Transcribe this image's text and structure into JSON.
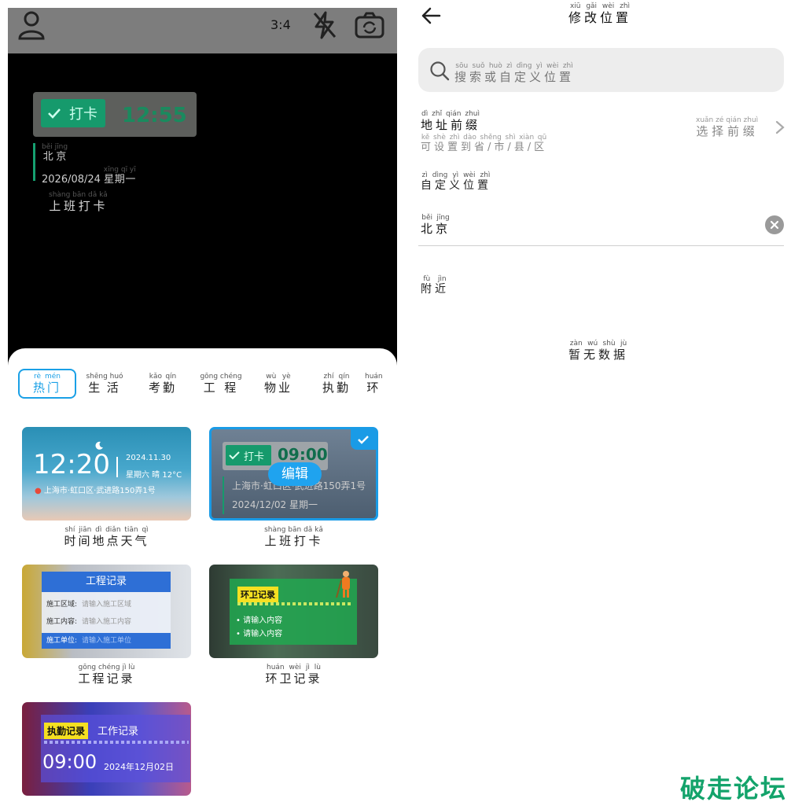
{
  "camera": {
    "ratio": "3:4",
    "icons": [
      "user-icon",
      "flash-off-icon",
      "switch-camera-icon"
    ]
  },
  "watermark_preview": {
    "chip_label": "打卡",
    "time": "12:55",
    "city": "北京",
    "city_pinyin": "běi jīng",
    "date": "2026/08/24",
    "weekday": "星期一",
    "weekday_pinyin": "xīng qī yī",
    "subtitle": "上班打卡",
    "subtitle_pinyin": "shàng bān dǎ kǎ"
  },
  "tabs": [
    {
      "label": "热门",
      "pinyin": "rè mén",
      "active": true
    },
    {
      "label": "生活",
      "pinyin": "shēng huó",
      "active": false
    },
    {
      "label": "考勤",
      "pinyin": "kǎo qín",
      "active": false
    },
    {
      "label": "工程",
      "pinyin": "gōng chéng",
      "active": false
    },
    {
      "label": "物业",
      "pinyin": "wù yè",
      "active": false
    },
    {
      "label": "执勤",
      "pinyin": "zhí qín",
      "active": false
    },
    {
      "label": "环",
      "pinyin": "huán",
      "active": false
    }
  ],
  "templates": {
    "time_weather": {
      "label": "时间地点天气",
      "pinyin": "shí jiān dì diǎn tiān qì",
      "time": "12:20",
      "date": "2024.11.30",
      "weather": "星期六 晴 12°C",
      "address": "上海市·虹口区·武进路150弄1号"
    },
    "clock_in": {
      "label": "上班打卡",
      "pinyin": "shàng bān dǎ kǎ",
      "chip_label": "打卡",
      "time": "09:00",
      "address": "上海市·虹口区·武进路150弄1号",
      "date": "2024/12/02 星期一",
      "edit_label": "编辑",
      "selected": true
    },
    "engineering": {
      "label": "工程记录",
      "pinyin": "gōng chéng jì lù",
      "header": "工程记录",
      "area_label": "施工区域:",
      "area_placeholder": "请输入施工区域",
      "content_label": "施工内容:",
      "content_placeholder": "请输入施工内容",
      "unit_label": "施工单位:",
      "unit_placeholder": "请输入施工单位"
    },
    "sanitation": {
      "label": "环卫记录",
      "pinyin": "huán wèi jì lù",
      "tag": "环卫记录",
      "row1": "• 请输入内容",
      "row2": "• 请输入内容"
    },
    "duty": {
      "tag": "执勤记录",
      "title": "工作记录",
      "time": "09:00",
      "date": "2024年12月02日"
    }
  },
  "edit_location": {
    "title": "修改位置",
    "title_pinyin": "xiū gǎi wèi zhì",
    "search_placeholder": "搜索或自定义位置",
    "search_pinyin": "sōu suǒ huò zì dìng yì wèi zhì",
    "prefix_label": "地址前缀",
    "prefix_label_pinyin": "dì zhǐ qián zhuì",
    "prefix_hint": "可设置到省/市/县/区",
    "prefix_hint_pinyin": "kě shè zhì dào shěng shì xiàn qū",
    "prefix_select": "选择前缀",
    "prefix_select_pinyin": "xuǎn zé qián zhuì",
    "custom_label": "自定义位置",
    "custom_label_pinyin": "zì dìng yì wèi zhì",
    "location_value": "北京",
    "location_value_pinyin": "běi jīng",
    "nearby_label": "附近",
    "nearby_pinyin": "fù jìn",
    "empty_text": "暂无数据",
    "empty_pinyin": "zàn wú shù jù"
  },
  "site_watermark": "破走论坛"
}
